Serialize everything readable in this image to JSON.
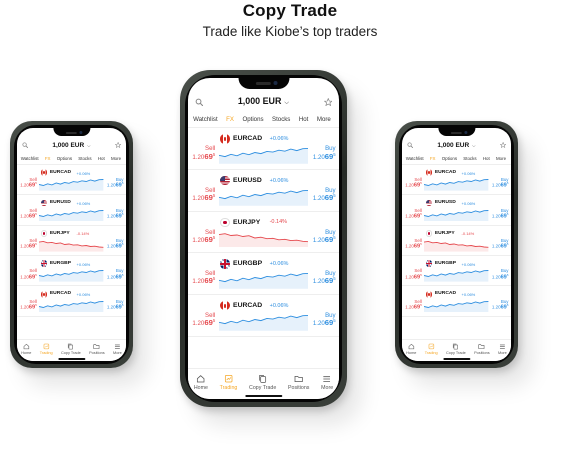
{
  "header": {
    "title": "Copy Trade",
    "subtitle": "Trade like Kiobe’s top traders"
  },
  "app": {
    "balance": "1,000 EUR",
    "tabs": [
      {
        "label": "Watchlist",
        "active": false
      },
      {
        "label": "FX",
        "active": true
      },
      {
        "label": "Options",
        "active": false
      },
      {
        "label": "Stocks",
        "active": false
      },
      {
        "label": "Hot",
        "active": false
      },
      {
        "label": "More",
        "active": false
      }
    ],
    "rows": [
      {
        "pair": "EURCAD",
        "flag": "ca",
        "change": "+0.06%",
        "trend": "up",
        "sell_label": "Sell",
        "sell_price": "1.20",
        "sell_pips": "69",
        "sell_sup": "5",
        "buy_label": "Buy",
        "buy_price": "1.20",
        "buy_pips": "69",
        "buy_sup": "5"
      },
      {
        "pair": "EURUSD",
        "flag": "us",
        "change": "+0.06%",
        "trend": "up",
        "sell_label": "Sell",
        "sell_price": "1.20",
        "sell_pips": "69",
        "sell_sup": "5",
        "buy_label": "Buy",
        "buy_price": "1.20",
        "buy_pips": "69",
        "buy_sup": "5"
      },
      {
        "pair": "EURJPY",
        "flag": "jp",
        "change": "-0.14%",
        "trend": "down",
        "sell_label": "Sell",
        "sell_price": "1.20",
        "sell_pips": "69",
        "sell_sup": "5",
        "buy_label": "Buy",
        "buy_price": "1.20",
        "buy_pips": "69",
        "buy_sup": "5"
      },
      {
        "pair": "EURGBP",
        "flag": "gb",
        "change": "+0.06%",
        "trend": "up",
        "sell_label": "Sell",
        "sell_price": "1.20",
        "sell_pips": "69",
        "sell_sup": "5",
        "buy_label": "Buy",
        "buy_price": "1.20",
        "buy_pips": "69",
        "buy_sup": "5"
      },
      {
        "pair": "EURCAD",
        "flag": "ca",
        "change": "+0.06%",
        "trend": "up",
        "sell_label": "Sell",
        "sell_price": "1.20",
        "sell_pips": "69",
        "sell_sup": "5",
        "buy_label": "Buy",
        "buy_price": "1.20",
        "buy_pips": "69",
        "buy_sup": "5"
      }
    ],
    "nav": [
      {
        "label": "Home",
        "icon": "home-icon",
        "active": false
      },
      {
        "label": "Trading",
        "icon": "trading-icon",
        "active": true
      },
      {
        "label": "Copy Trade",
        "icon": "copy-icon",
        "active": false
      },
      {
        "label": "Positions",
        "icon": "folder-icon",
        "active": false
      },
      {
        "label": "More",
        "icon": "menu-icon",
        "active": false
      }
    ],
    "colors": {
      "accent": "#f5a623",
      "up": "#2f8fe0",
      "down": "#e5484d"
    }
  }
}
